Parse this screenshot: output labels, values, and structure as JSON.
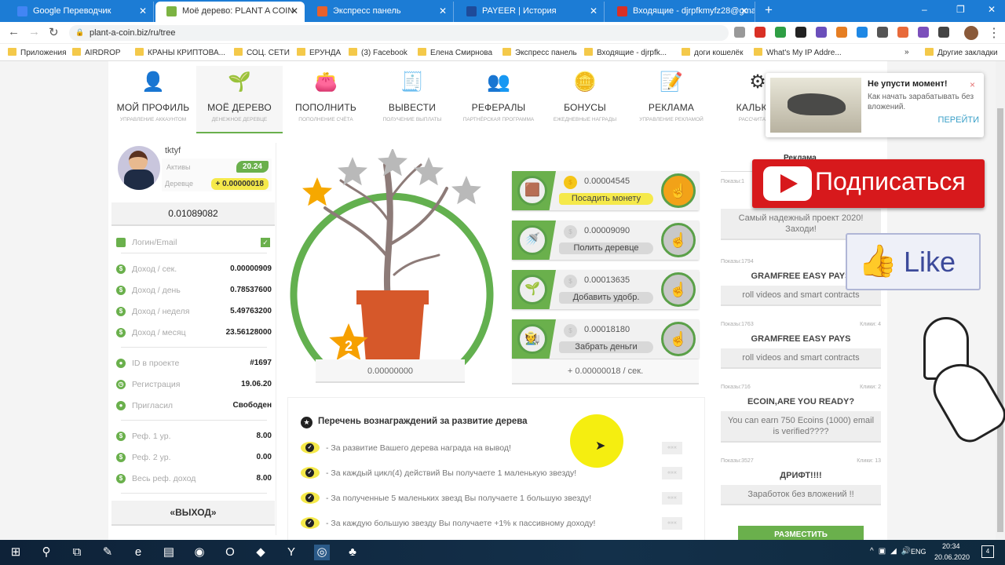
{
  "browser": {
    "tabs": [
      {
        "title": "Google Переводчик",
        "icon": "translate-icon",
        "color": "#4285f4"
      },
      {
        "title": "Моё дерево: PLANT A COIN",
        "icon": "plant-icon",
        "color": "#7cb342",
        "active": true
      },
      {
        "title": "Экспресс панель",
        "icon": "express-panel-icon",
        "color": "#e8612c"
      },
      {
        "title": "PAYEER | История",
        "icon": "payeer-icon",
        "color": "#1e4b9a"
      },
      {
        "title": "Входящие - djrpfkmyfz28@gma",
        "icon": "gmail-icon",
        "color": "#d93025"
      }
    ],
    "new_tab": "+",
    "url": "plant-a-coin.biz/ru/tree",
    "bookmarks": [
      "Приложения",
      "AIRDROP",
      "КРАНЫ КРИПТОВА...",
      "СОЦ. СЕТИ",
      "ЕРУНДА",
      "(3) Facebook",
      "Елена Смирнова",
      "Экспресс панель",
      "Входящие - djrpfk...",
      "доги кошелёк",
      "What's My IP Addre..."
    ],
    "bookmarks_more": "»",
    "other_bookmarks": "Другие закладки"
  },
  "nav": [
    {
      "title": "МОЙ ПРОФИЛЬ",
      "sub": "УПРАВЛЕНИЕ АККАУНТОМ",
      "icon": "profile-icon"
    },
    {
      "title": "МОЁ ДЕРЕВО",
      "sub": "ДЕНЕЖНОЕ ДЕРЕВЦЕ",
      "icon": "tree-icon",
      "active": true
    },
    {
      "title": "ПОПОЛНИТЬ",
      "sub": "ПОПОЛНЕНИЕ СЧЁТА",
      "icon": "wallet-icon"
    },
    {
      "title": "ВЫВЕСТИ",
      "sub": "ПОЛУЧЕНИЕ ВЫПЛАТЫ",
      "icon": "withdraw-icon"
    },
    {
      "title": "РЕФЕРАЛЫ",
      "sub": "ПАРТНЁРСКАЯ ПРОГРАММА",
      "icon": "referrals-icon"
    },
    {
      "title": "БОНУСЫ",
      "sub": "ЕЖЕДНЕВНЫЕ НАГРАДЫ",
      "icon": "coins-icon"
    },
    {
      "title": "РЕКЛАМА",
      "sub": "УПРАВЛЕНИЕ РЕКЛАМОЙ",
      "icon": "advert-icon"
    },
    {
      "title": "КАЛЬКУЛ",
      "sub": "РАССЧИТАТЬ П",
      "icon": "gears-icon"
    }
  ],
  "profile": {
    "username": "tktyf",
    "assets_label": "Активы",
    "assets_value": "20.24",
    "tree_label": "Деревце",
    "tree_value": "+ 0.00000018",
    "balance": "0.01089082",
    "login_label": "Логин/Email",
    "income": [
      {
        "label": "Доход / сек.",
        "value": "0.00000909"
      },
      {
        "label": "Доход / день",
        "value": "0.78537600"
      },
      {
        "label": "Доход / неделя",
        "value": "5.49763200"
      },
      {
        "label": "Доход / месяц",
        "value": "23.56128000"
      }
    ],
    "info": [
      {
        "label": "ID в проекте",
        "value": "#1697",
        "icon": "user-icon"
      },
      {
        "label": "Регистрация",
        "value": "19.06.20",
        "icon": "clock-icon"
      },
      {
        "label": "Пригласил",
        "value": "Свободен",
        "icon": "users-icon"
      }
    ],
    "ref": [
      {
        "label": "Реф. 1 ур.",
        "value": "8.00"
      },
      {
        "label": "Реф. 2 ур.",
        "value": "0.00"
      },
      {
        "label": "Весь реф. доход",
        "value": "8.00"
      }
    ],
    "logout": "«ВЫХОД»"
  },
  "tree": {
    "stars_earned": 1,
    "stars_total": 5,
    "big_stars": 2,
    "counter": "0.00000000"
  },
  "actions": [
    {
      "amount": "0.00004545",
      "label": "Посадить монету",
      "icon": "seed-bag-icon",
      "active": true
    },
    {
      "amount": "0.00009090",
      "label": "Полить деревце",
      "icon": "watering-can-icon"
    },
    {
      "amount": "0.00013635",
      "label": "Добавить удобр.",
      "icon": "fertilizer-icon"
    },
    {
      "amount": "0.00018180",
      "label": "Забрать деньги",
      "icon": "harvest-icon"
    }
  ],
  "rate": "+ 0.00000018 / сек.",
  "rewards": {
    "title": "Перечень вознаграждений за развитие дерева",
    "more": "«««",
    "items": [
      "- За развитие Вашего дерева награда на вывод!",
      "- За каждый цикл(4) действий Вы получаете 1 маленькую звезду!",
      "- За полученные 5 маленьких звезд Вы получаете 1 большую звезду!",
      "- За каждую большую звезду Вы получаете +1% к пассивному доходу!"
    ]
  },
  "ads": {
    "title": "Реклама",
    "items": [
      {
        "views": "Показы:1",
        "clicks": "",
        "title": "",
        "body": "Самый надежный проект 2020! Заходи!"
      },
      {
        "views": "Показы:1794",
        "clicks": "",
        "title": "GRAMFREE EASY PAYS",
        "body": "roll videos and smart contracts"
      },
      {
        "views": "Показы:1763",
        "clicks": "Клики: 4",
        "title": "GRAMFREE EASY PAYS",
        "body": "roll videos and smart contracts"
      },
      {
        "views": "Показы:716",
        "clicks": "Клики: 2",
        "title": "ECOIN,ARE YOU READY?",
        "body": "You can earn 750 Ecoins (1000) email is verified????"
      },
      {
        "views": "Показы:3527",
        "clicks": "Клики: 13",
        "title": "ДРИФТ!!!!",
        "body": "Заработок без вложений !!"
      }
    ],
    "place_button": "РАЗМЕСТИТЬ"
  },
  "notification": {
    "title": "Не упусти момент!",
    "text": "Как начать зарабатывать без вложений.",
    "action": "ПЕРЕЙТИ",
    "close": "×"
  },
  "overlays": {
    "subscribe": "Подписаться",
    "like": "Like"
  },
  "taskbar": {
    "lang": "ENG",
    "time": "20:34",
    "date": "20.06.2020",
    "notifications": "4"
  },
  "colors": {
    "accent": "#6ab04c",
    "yellow": "#f5e94a",
    "youtube": "#d7191c",
    "tabbar": "#1c7cd5"
  }
}
